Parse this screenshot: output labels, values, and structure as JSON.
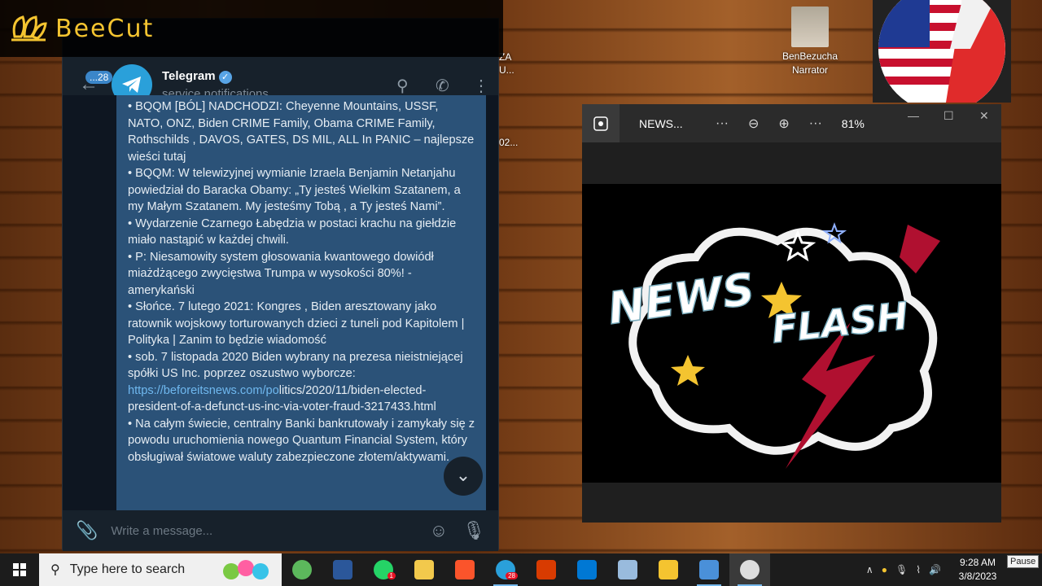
{
  "watermark": {
    "brand": "BeeCut"
  },
  "desktop": {
    "user_label_line1": "BenBezucha",
    "user_label_line2": "Narrator",
    "fragment_1a": "ZA",
    "fragment_1b": "U...",
    "fragment_2": "02..."
  },
  "telegram": {
    "unread_badge": "...28",
    "title": "Telegram",
    "subtitle": "service notifications",
    "message_lines": [
      "•  BQQM [BÓL] NADCHODZI: Cheyenne Mountains, USSF, NATO, ONZ, Biden CRIME Family, Obama CRIME Family, Rothschilds , DAVOS, GATES, DS MIL, ALL In PANIC – najlepsze wieści tutaj",
      "•  BQQM: W telewizyjnej wymianie Izraela Benjamin Netanjahu powiedział do Baracka Obamy: „Ty jesteś Wielkim Szatanem, a my Małym Szatanem. My jesteśmy Tobą , a Ty jesteś Nami”.",
      "•  Wydarzenie Czarnego Łabędzia w postaci krachu na giełdzie miało nastąpić w każdej chwili.",
      "•  P: Niesamowity system głosowania kwantowego dowiódł miażdżącego zwycięstwa Trumpa w wysokości 80%! - amerykański",
      "•  Słońce. 7 lutego 2021: Kongres , Biden aresztowany jako ratownik wojskowy torturowanych dzieci z tuneli pod Kapitolem | Polityka | Zanim to będzie wiadomość",
      "•  sob. 7 listopada 2020 Biden wybrany na prezesa nieistniejącej spółki US Inc. poprzez oszustwo wyborcze:"
    ],
    "link_part1": "https://beforeitsnews.com/po",
    "link_part2": "litics/2020/11/biden-elected-president-of-a-defunct-us-inc-via-voter-fraud-3217433.html",
    "message_lines_after": [
      "•  Na całym świecie, centralny Banki bankrutowały i zamykały się z powodu uruchomienia nowego Quantum Financial System, który obsługiwał światowe waluty zabezpieczone złotem/aktywami."
    ],
    "input_placeholder": "Write a message..."
  },
  "photos": {
    "title": "NEWS...",
    "zoom": "81%",
    "image_text_1": "NEWS",
    "image_text_2": "FLASH"
  },
  "taskbar": {
    "search_placeholder": "Type here to search",
    "telegram_badge": "28",
    "whatsapp_badge": "1",
    "time": "9:28 AM",
    "date": "3/8/2023",
    "tooltip": "Pause"
  },
  "colors": {
    "telegram_bubble": "#2b5278",
    "telegram_bg": "#0e1621",
    "accent": "#2aa0da",
    "beecut": "#f4c430"
  }
}
